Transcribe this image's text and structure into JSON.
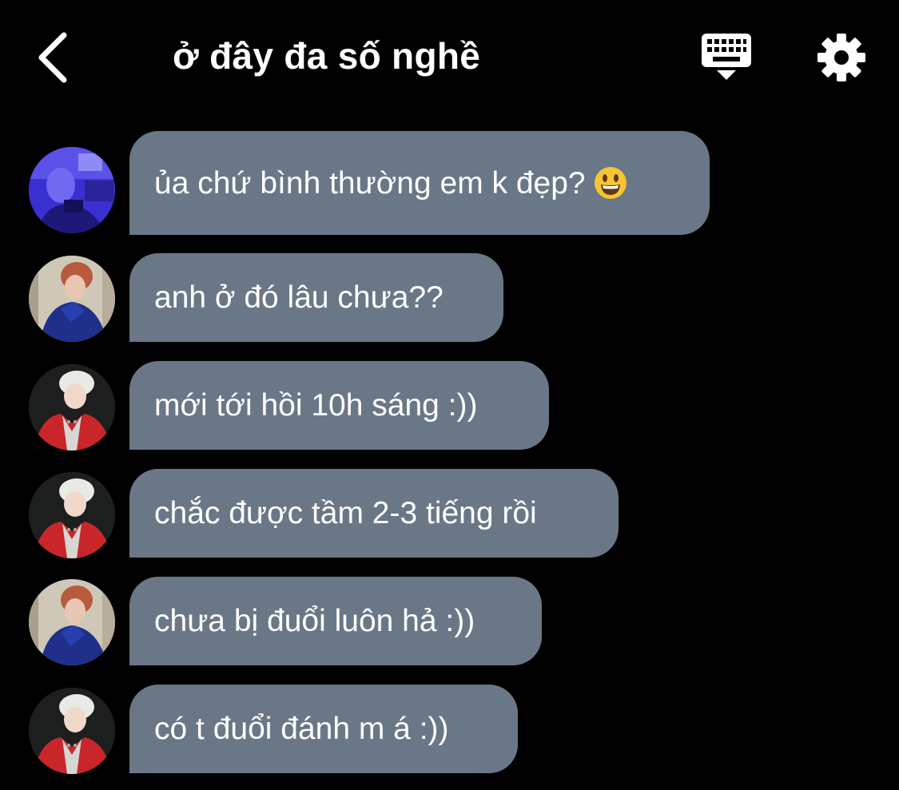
{
  "header": {
    "title": "ở đây đa số nghề",
    "back_icon": "chevron-left-icon",
    "keyboard_icon": "keyboard-icon",
    "settings_icon": "gear-icon"
  },
  "messages": [
    {
      "text": "ủa chứ bình thường em k đẹp?",
      "avatar": "avatar-purple-photo",
      "emoji": "grinning-face-emoji"
    },
    {
      "text": "anh ở đó lâu chưa??",
      "avatar": "avatar-blue-jacket"
    },
    {
      "text": "mới tới hồi 10h sáng :))",
      "avatar": "avatar-red-jacket"
    },
    {
      "text": "chắc được tầm 2-3 tiếng rồi",
      "avatar": "avatar-red-jacket"
    },
    {
      "text": "chưa bị đuổi luôn hả :))",
      "avatar": "avatar-blue-jacket"
    },
    {
      "text": "có t đuổi đánh m á :))",
      "avatar": "avatar-red-jacket"
    }
  ],
  "colors": {
    "background": "#000000",
    "bubble": "#6a7787",
    "text": "#ffffff"
  }
}
